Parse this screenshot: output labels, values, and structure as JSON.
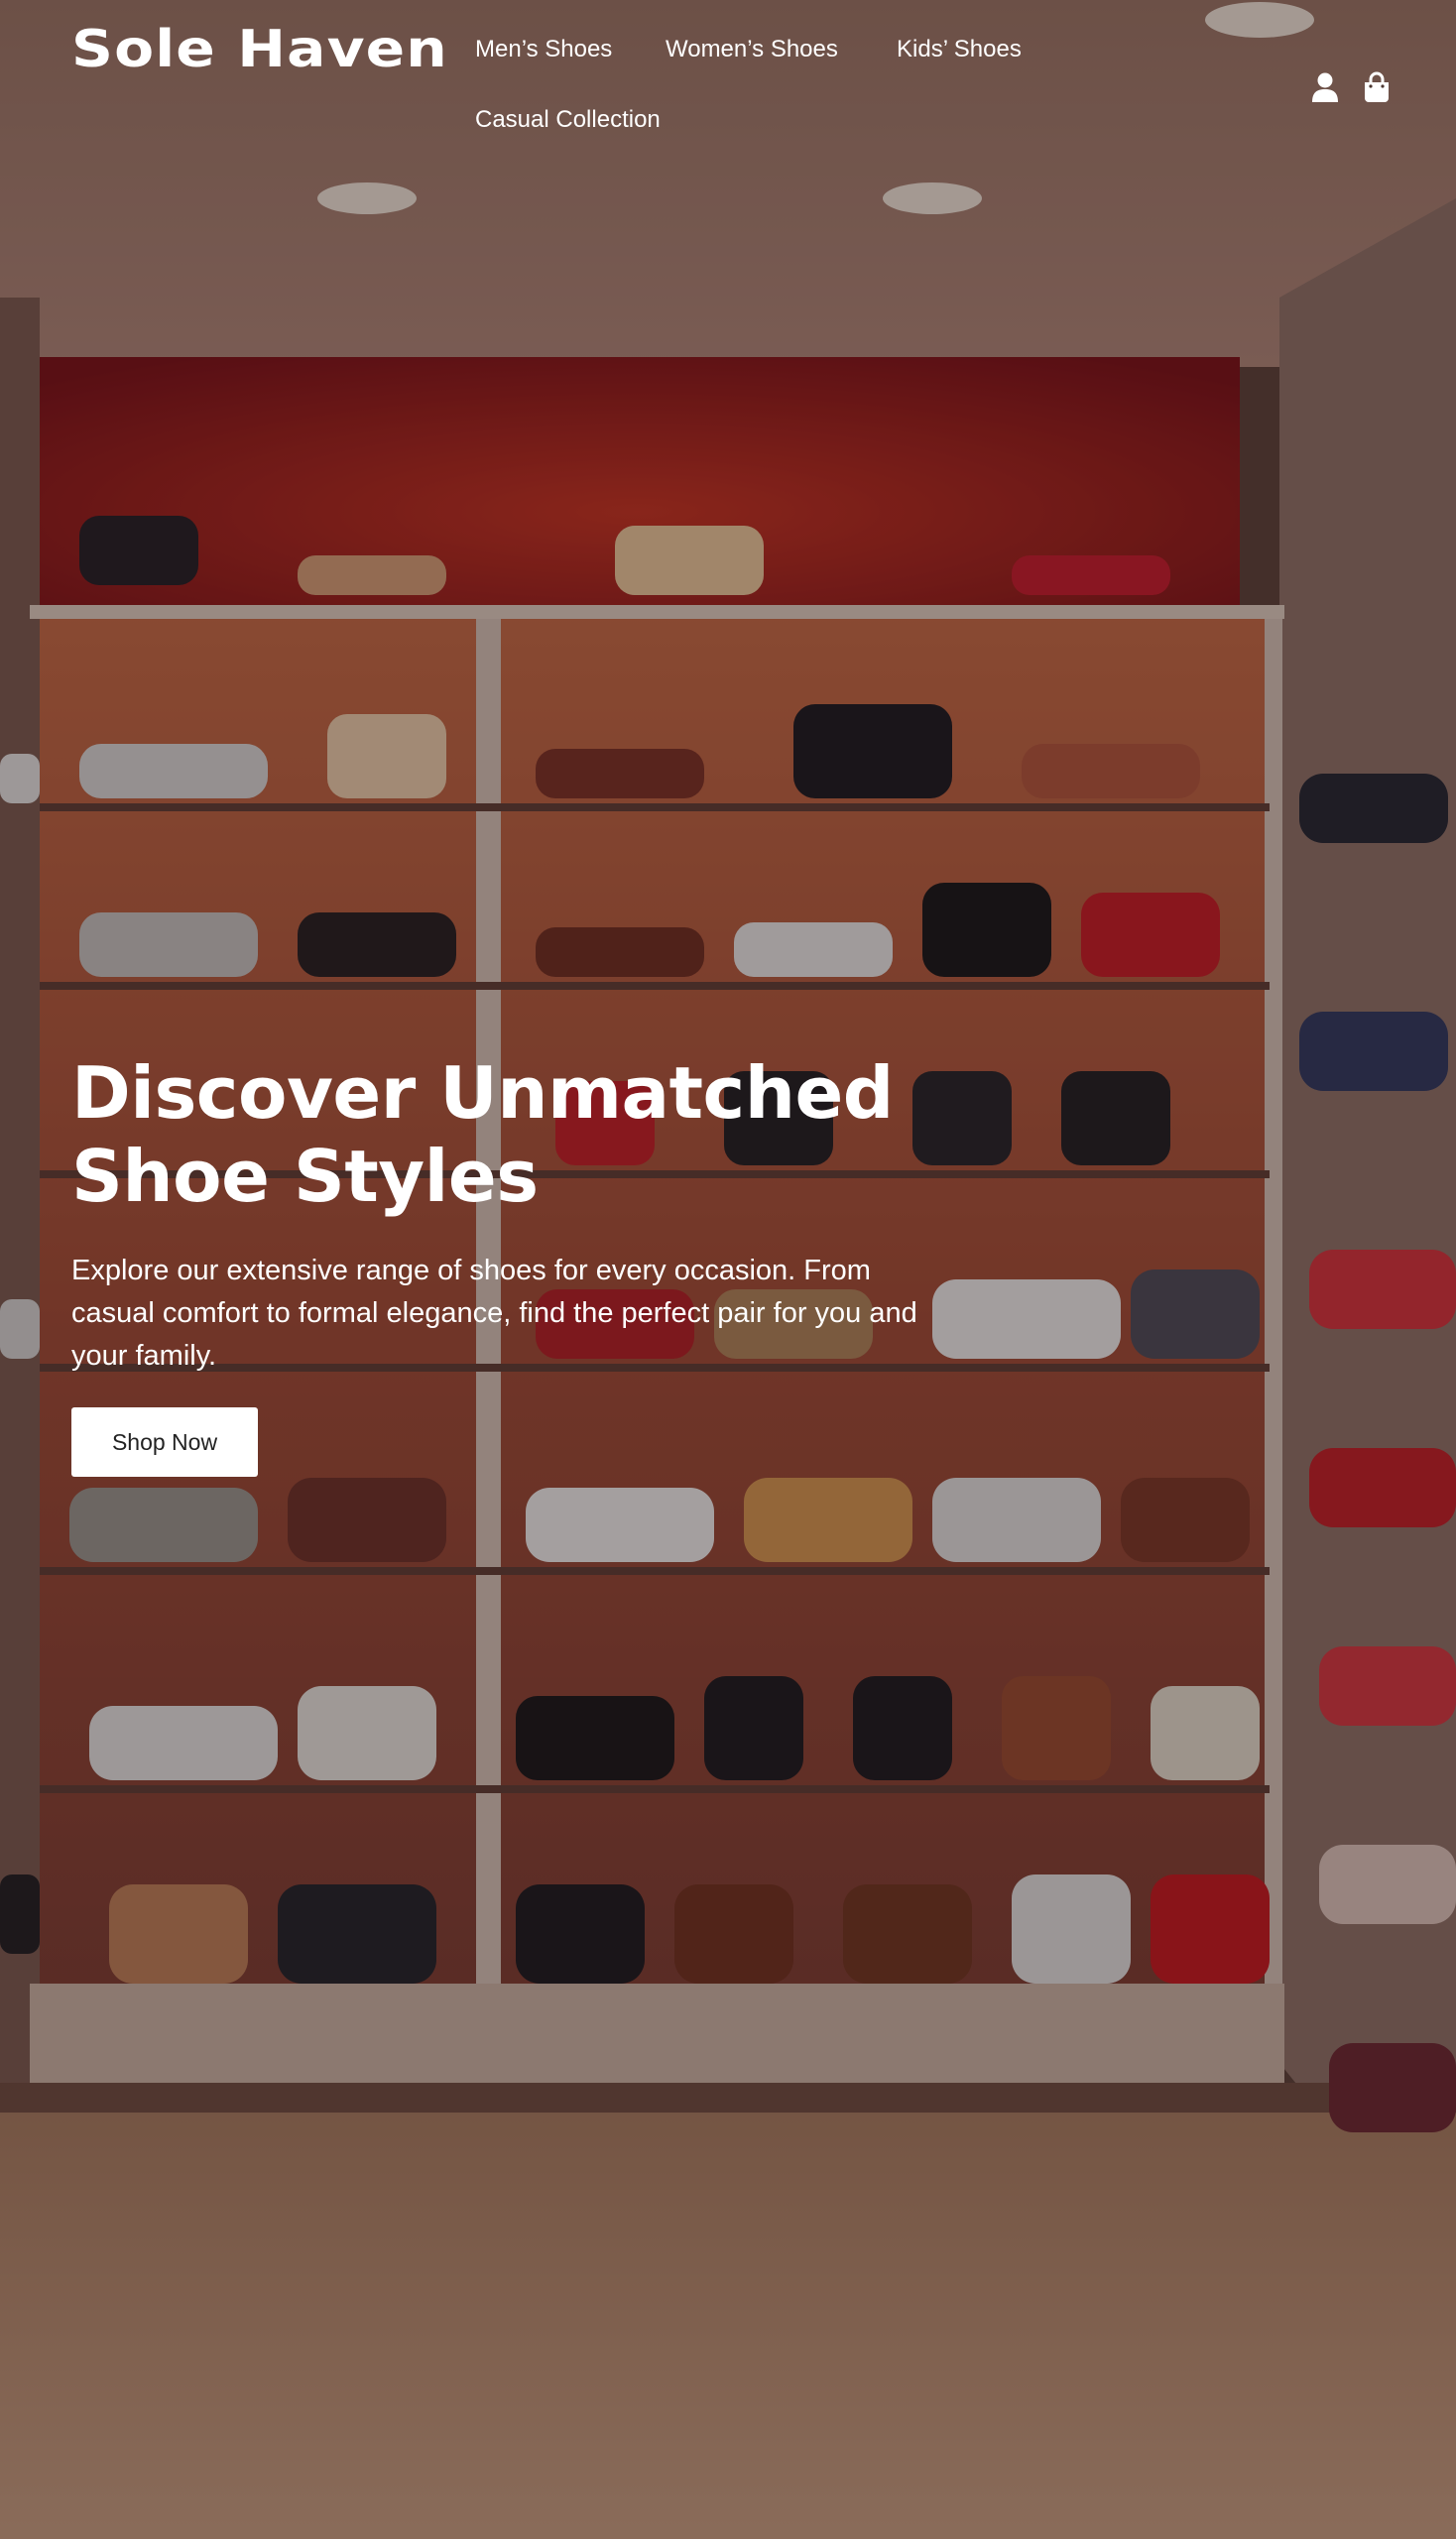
{
  "brand": {
    "name": "Sole Haven"
  },
  "nav": {
    "items": [
      {
        "label": "Men’s Shoes"
      },
      {
        "label": "Women’s Shoes"
      },
      {
        "label": "Kids’ Shoes"
      },
      {
        "label": "Casual Collection"
      }
    ]
  },
  "header_icons": [
    {
      "icon": "user-icon"
    },
    {
      "icon": "shopping-bag-icon"
    }
  ],
  "hero": {
    "title_line1": "Discover Unmatched",
    "title_line2": "Shoe Styles",
    "description": "Explore our extensive range of shoes for every occasion. From casual comfort to formal elegance, find the perfect pair for you and your family.",
    "cta_label": "Shop Now"
  },
  "colors": {
    "text_primary": "#ffffff",
    "button_bg": "#ffffff",
    "button_text": "#222222",
    "accent_wall": "#8e1418"
  }
}
